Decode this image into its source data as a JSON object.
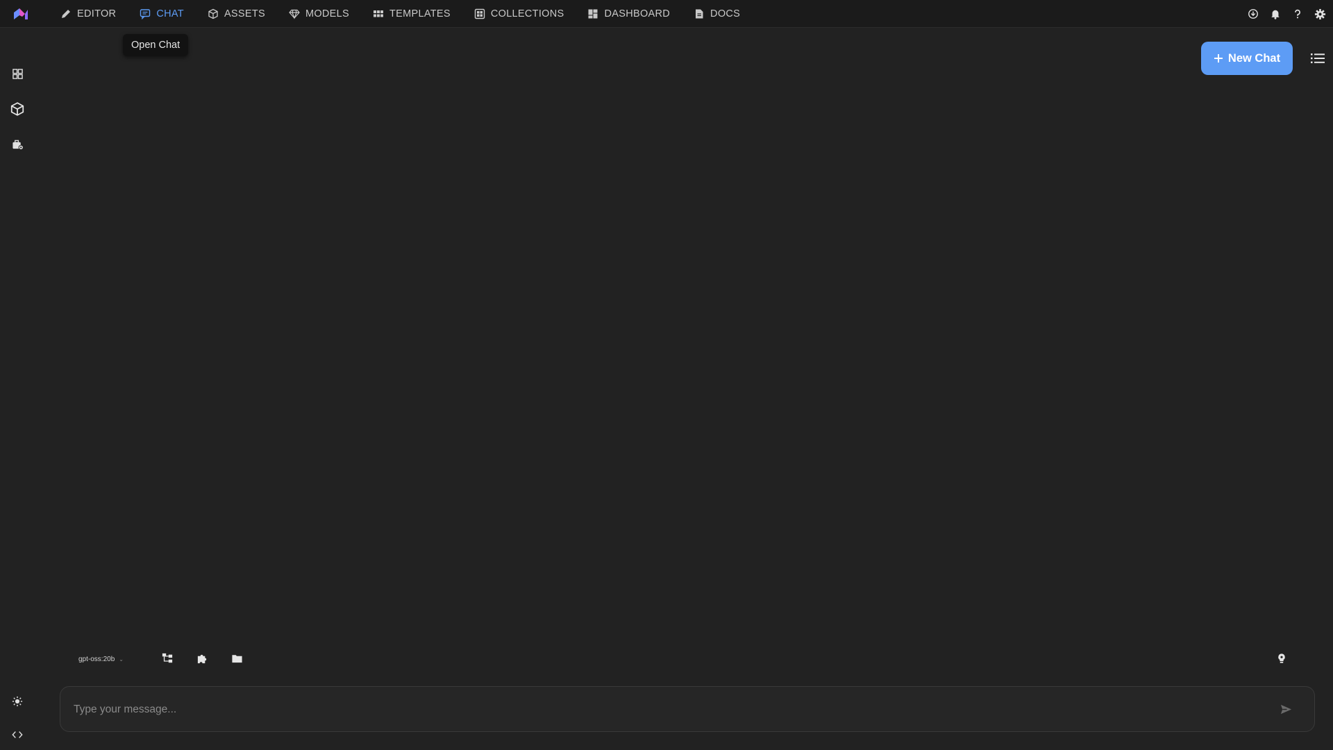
{
  "app": {
    "logo_name": "app-logo"
  },
  "nav": {
    "items": [
      {
        "label": "EDITOR",
        "icon": "pencil-icon"
      },
      {
        "label": "CHAT",
        "icon": "chat-icon",
        "active": true
      },
      {
        "label": "ASSETS",
        "icon": "cube-icon"
      },
      {
        "label": "MODELS",
        "icon": "gem-icon"
      },
      {
        "label": "TEMPLATES",
        "icon": "grid-icon"
      },
      {
        "label": "COLLECTIONS",
        "icon": "collection-icon"
      },
      {
        "label": "DASHBOARD",
        "icon": "dashboard-icon"
      },
      {
        "label": "DOCS",
        "icon": "document-icon"
      }
    ]
  },
  "tooltip": {
    "text": "Open Chat"
  },
  "header_actions": {
    "new_chat_label": "New Chat"
  },
  "composer": {
    "model": "gpt-oss:20b",
    "placeholder": "Type your message..."
  },
  "colors": {
    "accent": "#5d9cf5",
    "background": "#222222",
    "topbar": "#1b1b1b"
  }
}
